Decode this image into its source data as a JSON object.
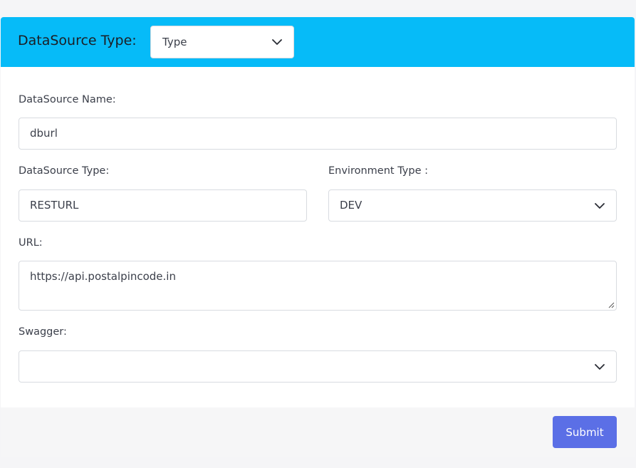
{
  "header": {
    "title": "DataSource Type:",
    "type_select_value": "Type"
  },
  "form": {
    "name_label": "DataSource Name:",
    "name_value": "dburl",
    "type_label": "DataSource Type:",
    "type_value": "RESTURL",
    "env_label": "Environment Type :",
    "env_value": "DEV",
    "url_label": "URL:",
    "url_value": "https://api.postalpincode.in",
    "swagger_label": "Swagger:",
    "swagger_value": ""
  },
  "footer": {
    "submit_label": "Submit"
  },
  "colors": {
    "header_bg": "#06bbf8",
    "submit_bg": "#5b6fe6"
  }
}
